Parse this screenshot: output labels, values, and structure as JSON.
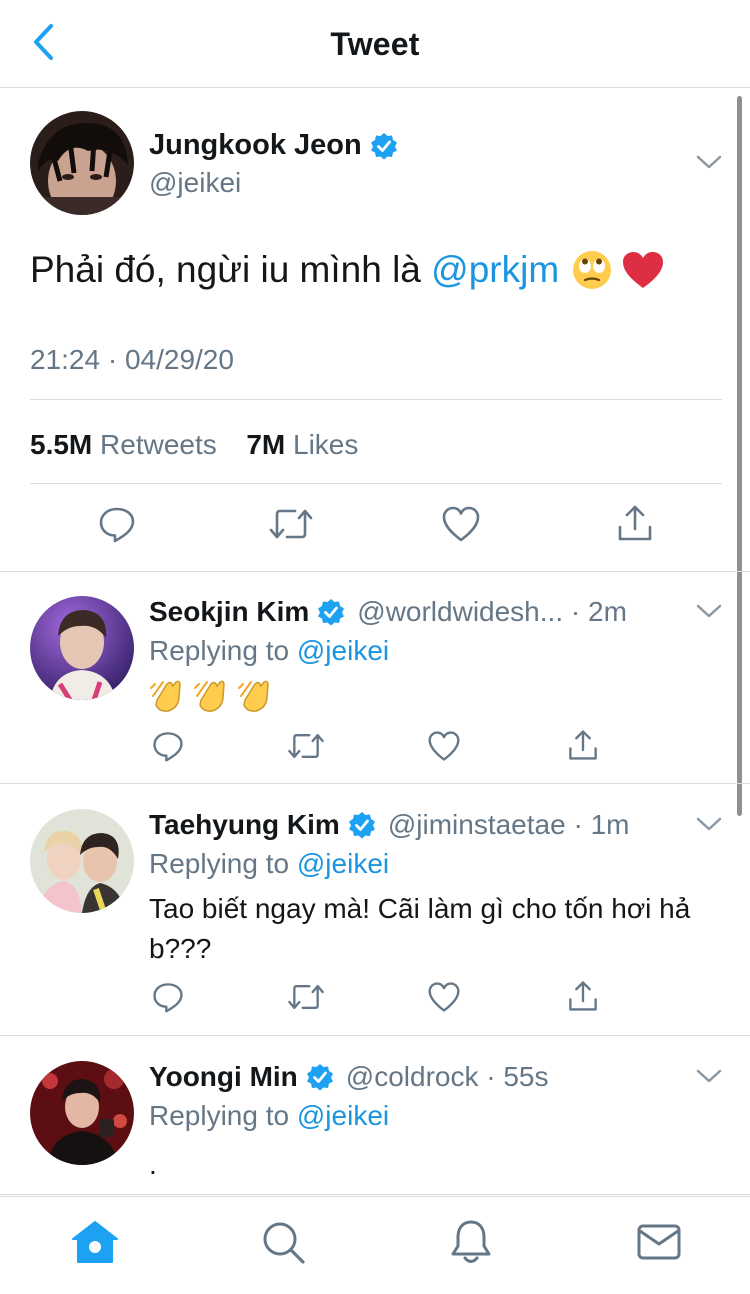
{
  "header": {
    "title": "Tweet",
    "back_icon": "chevron-left-icon"
  },
  "colors": {
    "accent": "#1da1f2",
    "mention": "#1b95e0",
    "secondary_text": "#657786",
    "heart": "#dd2e44"
  },
  "main_tweet": {
    "author_name": "Jungkook Jeon",
    "handle": "@jeikei",
    "text_before": "Phải đó, ngừi iu mình là ",
    "mention": "@prkjm",
    "emojis": [
      "face-with-rolling-eyes-emoji",
      "red-heart-emoji"
    ],
    "timestamp": "21:24 · 04/29/20",
    "retweet_count": "5.5M",
    "retweet_label": "Retweets",
    "like_count": "7M",
    "like_label": "Likes"
  },
  "replies": [
    {
      "author_name": "Seokjin Kim",
      "handle": "@worldwidesh...",
      "time": " · 2m",
      "replying_label": "Replying to ",
      "replying_to": "@jeikei",
      "text": "",
      "emojis": [
        "clapping-hands-emoji",
        "clapping-hands-emoji",
        "clapping-hands-emoji"
      ]
    },
    {
      "author_name": "Taehyung Kim",
      "handle": "@jiminstaetae",
      "time": " · 1m",
      "replying_label": "Replying to ",
      "replying_to": "@jeikei",
      "text": "Tao biết ngay mà! Cãi làm gì cho tốn hơi hả b???"
    },
    {
      "author_name": "Yoongi Min",
      "handle": "@coldrock",
      "time": " · 55s",
      "replying_label": "Replying to ",
      "replying_to": "@jeikei",
      "text": "."
    }
  ],
  "tabbar": {
    "tabs": [
      "home-icon",
      "search-icon",
      "notifications-bell-icon",
      "messages-envelope-icon"
    ]
  }
}
